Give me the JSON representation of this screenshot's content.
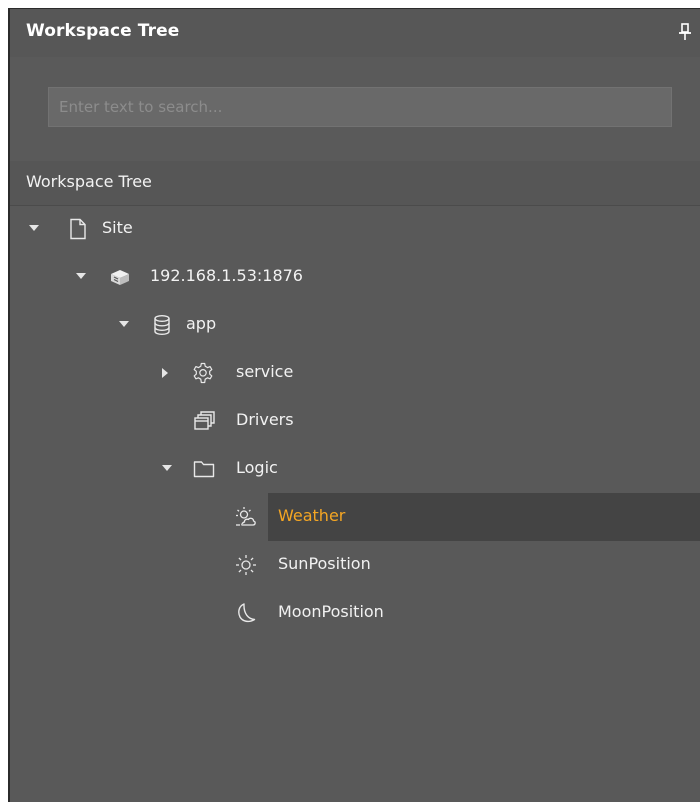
{
  "panel": {
    "title": "Workspace Tree",
    "pin_icon": "pin-icon"
  },
  "search": {
    "value": "",
    "placeholder": "Enter text to search..."
  },
  "section": {
    "header": "Workspace Tree"
  },
  "tree": {
    "nodes": [
      {
        "label": "Site",
        "icon": "file-icon",
        "expander": "expanded"
      },
      {
        "label": "192.168.1.53:1876",
        "icon": "server-icon",
        "expander": "expanded"
      },
      {
        "label": "app",
        "icon": "database-icon",
        "expander": "expanded"
      },
      {
        "label": "service",
        "icon": "gear-icon",
        "expander": "collapsed"
      },
      {
        "label": "Drivers",
        "icon": "windows-stack-icon",
        "expander": "none"
      },
      {
        "label": "Logic",
        "icon": "folder-icon",
        "expander": "expanded"
      },
      {
        "label": "Weather",
        "icon": "weather-icon",
        "expander": "none",
        "selected": true
      },
      {
        "label": "SunPosition",
        "icon": "sun-icon",
        "expander": "none"
      },
      {
        "label": "MoonPosition",
        "icon": "moon-icon",
        "expander": "none"
      }
    ]
  },
  "colors": {
    "panel_bg": "#595959",
    "selected_bg": "#444444",
    "selected_text": "#f5a623",
    "text": "#f2f2f2"
  }
}
